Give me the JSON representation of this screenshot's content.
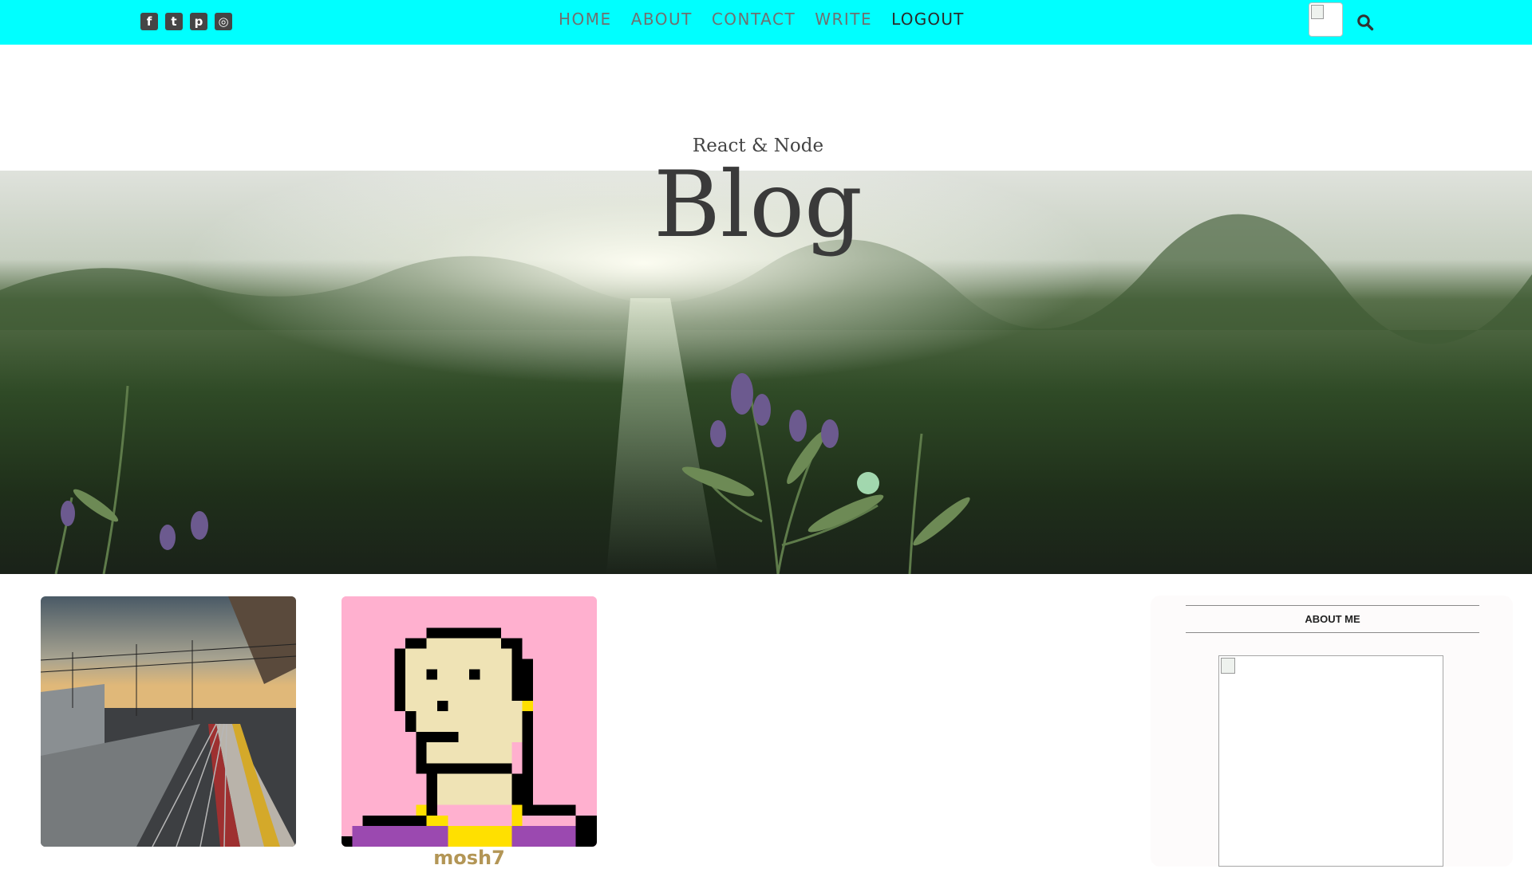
{
  "topbar": {
    "social_icons": [
      "facebook-square-icon",
      "twitter-square-icon",
      "pinterest-square-icon",
      "instagram-icon"
    ],
    "social_glyphs": [
      "f",
      "t",
      "p",
      "◎"
    ],
    "nav": {
      "home": "HOME",
      "about": "ABOUT",
      "contact": "CONTACT",
      "write": "WRITE",
      "logout": "LOGOUT"
    },
    "accent_color": "#00ffff"
  },
  "header": {
    "subtitle": "React & Node",
    "title": "Blog"
  },
  "posts": [
    {
      "image": "railway-platform-photo"
    },
    {
      "image": "pixel-art-avatar",
      "author": "mosh7"
    }
  ],
  "sidebar": {
    "title": "ABOUT ME"
  }
}
